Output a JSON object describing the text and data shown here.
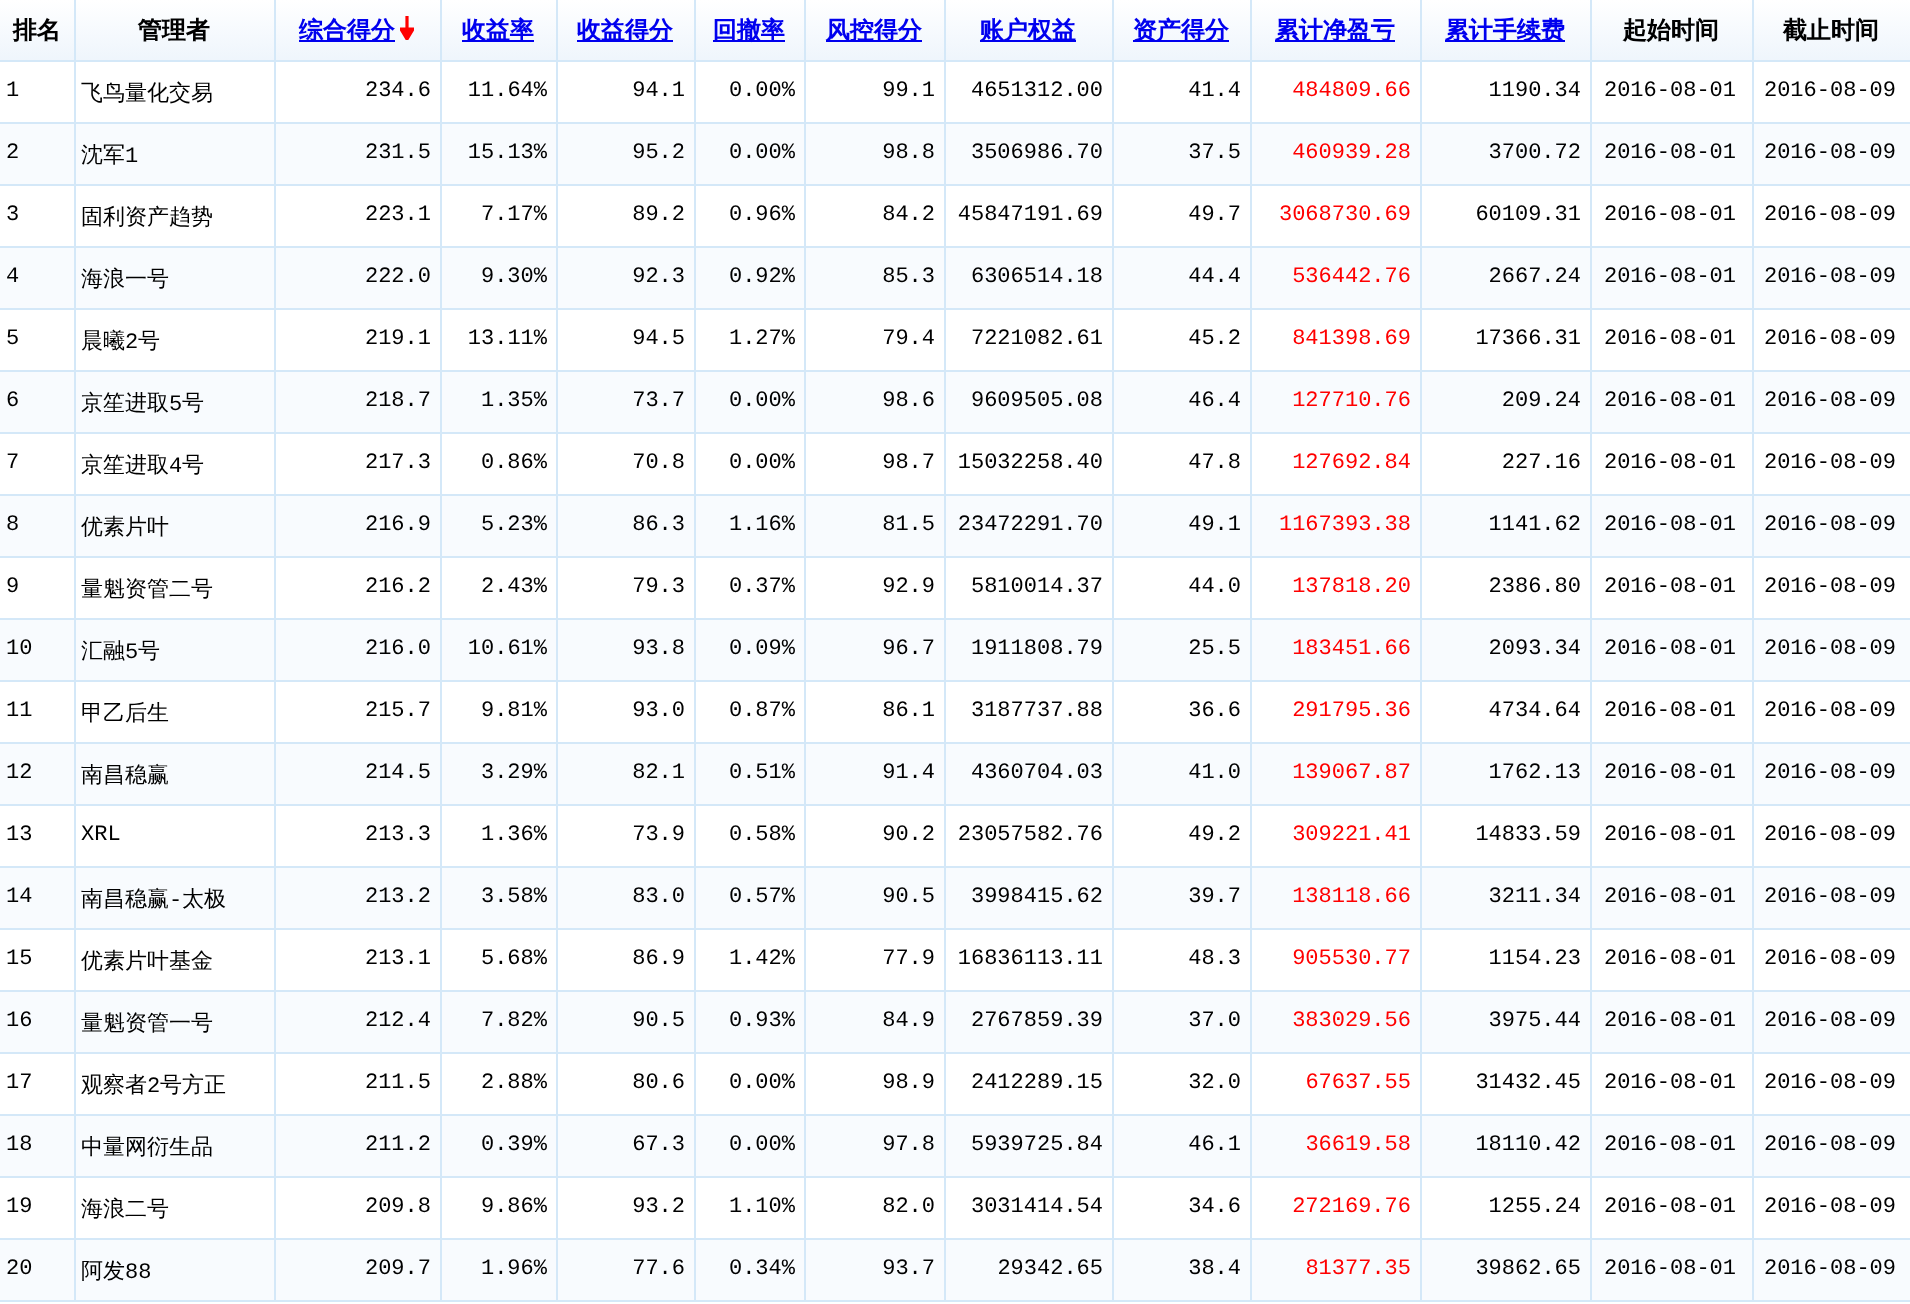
{
  "table": {
    "columns": [
      {
        "label": "排名",
        "kind": "plain"
      },
      {
        "label": "管理者",
        "kind": "plain"
      },
      {
        "label": "综合得分",
        "kind": "link",
        "sorted": true
      },
      {
        "label": "收益率",
        "kind": "link",
        "sorted": false
      },
      {
        "label": "收益得分",
        "kind": "link",
        "sorted": false
      },
      {
        "label": "回撤率",
        "kind": "link",
        "sorted": false
      },
      {
        "label": "风控得分",
        "kind": "link",
        "sorted": false
      },
      {
        "label": "账户权益",
        "kind": "link",
        "sorted": false
      },
      {
        "label": "资产得分",
        "kind": "link",
        "sorted": false
      },
      {
        "label": "累计净盈亏",
        "kind": "link",
        "sorted": false,
        "color": "#ff0000"
      },
      {
        "label": "累计手续费",
        "kind": "link",
        "sorted": false
      },
      {
        "label": "起始时间",
        "kind": "plain"
      },
      {
        "label": "截止时间",
        "kind": "plain"
      }
    ],
    "rows": [
      {
        "cells": [
          "1",
          "飞鸟量化交易",
          "234.6",
          "11.64%",
          "94.1",
          "0.00%",
          "99.1",
          "4651312.00",
          "41.4",
          "484809.66",
          "1190.34",
          "2016-08-01",
          "2016-08-09"
        ]
      },
      {
        "cells": [
          "2",
          "沈军1",
          "231.5",
          "15.13%",
          "95.2",
          "0.00%",
          "98.8",
          "3506986.70",
          "37.5",
          "460939.28",
          "3700.72",
          "2016-08-01",
          "2016-08-09"
        ]
      },
      {
        "cells": [
          "3",
          "固利资产趋势",
          "223.1",
          "7.17%",
          "89.2",
          "0.96%",
          "84.2",
          "45847191.69",
          "49.7",
          "3068730.69",
          "60109.31",
          "2016-08-01",
          "2016-08-09"
        ]
      },
      {
        "cells": [
          "4",
          "海浪一号",
          "222.0",
          "9.30%",
          "92.3",
          "0.92%",
          "85.3",
          "6306514.18",
          "44.4",
          "536442.76",
          "2667.24",
          "2016-08-01",
          "2016-08-09"
        ]
      },
      {
        "cells": [
          "5",
          "晨曦2号",
          "219.1",
          "13.11%",
          "94.5",
          "1.27%",
          "79.4",
          "7221082.61",
          "45.2",
          "841398.69",
          "17366.31",
          "2016-08-01",
          "2016-08-09"
        ]
      },
      {
        "cells": [
          "6",
          "京笙进取5号",
          "218.7",
          "1.35%",
          "73.7",
          "0.00%",
          "98.6",
          "9609505.08",
          "46.4",
          "127710.76",
          "209.24",
          "2016-08-01",
          "2016-08-09"
        ]
      },
      {
        "cells": [
          "7",
          "京笙进取4号",
          "217.3",
          "0.86%",
          "70.8",
          "0.00%",
          "98.7",
          "15032258.40",
          "47.8",
          "127692.84",
          "227.16",
          "2016-08-01",
          "2016-08-09"
        ]
      },
      {
        "cells": [
          "8",
          "优素片叶",
          "216.9",
          "5.23%",
          "86.3",
          "1.16%",
          "81.5",
          "23472291.70",
          "49.1",
          "1167393.38",
          "1141.62",
          "2016-08-01",
          "2016-08-09"
        ]
      },
      {
        "cells": [
          "9",
          "量魁资管二号",
          "216.2",
          "2.43%",
          "79.3",
          "0.37%",
          "92.9",
          "5810014.37",
          "44.0",
          "137818.20",
          "2386.80",
          "2016-08-01",
          "2016-08-09"
        ]
      },
      {
        "cells": [
          "10",
          "汇融5号",
          "216.0",
          "10.61%",
          "93.8",
          "0.09%",
          "96.7",
          "1911808.79",
          "25.5",
          "183451.66",
          "2093.34",
          "2016-08-01",
          "2016-08-09"
        ]
      },
      {
        "cells": [
          "11",
          "甲乙后生",
          "215.7",
          "9.81%",
          "93.0",
          "0.87%",
          "86.1",
          "3187737.88",
          "36.6",
          "291795.36",
          "4734.64",
          "2016-08-01",
          "2016-08-09"
        ]
      },
      {
        "cells": [
          "12",
          "南昌稳赢",
          "214.5",
          "3.29%",
          "82.1",
          "0.51%",
          "91.4",
          "4360704.03",
          "41.0",
          "139067.87",
          "1762.13",
          "2016-08-01",
          "2016-08-09"
        ]
      },
      {
        "cells": [
          "13",
          "XRL",
          "213.3",
          "1.36%",
          "73.9",
          "0.58%",
          "90.2",
          "23057582.76",
          "49.2",
          "309221.41",
          "14833.59",
          "2016-08-01",
          "2016-08-09"
        ]
      },
      {
        "cells": [
          "14",
          "南昌稳赢-太极",
          "213.2",
          "3.58%",
          "83.0",
          "0.57%",
          "90.5",
          "3998415.62",
          "39.7",
          "138118.66",
          "3211.34",
          "2016-08-01",
          "2016-08-09"
        ]
      },
      {
        "cells": [
          "15",
          "优素片叶基金",
          "213.1",
          "5.68%",
          "86.9",
          "1.42%",
          "77.9",
          "16836113.11",
          "48.3",
          "905530.77",
          "1154.23",
          "2016-08-01",
          "2016-08-09"
        ]
      },
      {
        "cells": [
          "16",
          "量魁资管一号",
          "212.4",
          "7.82%",
          "90.5",
          "0.93%",
          "84.9",
          "2767859.39",
          "37.0",
          "383029.56",
          "3975.44",
          "2016-08-01",
          "2016-08-09"
        ]
      },
      {
        "cells": [
          "17",
          "观察者2号方正",
          "211.5",
          "2.88%",
          "80.6",
          "0.00%",
          "98.9",
          "2412289.15",
          "32.0",
          "67637.55",
          "31432.45",
          "2016-08-01",
          "2016-08-09"
        ]
      },
      {
        "cells": [
          "18",
          "中量网衍生品",
          "211.2",
          "0.39%",
          "67.3",
          "0.00%",
          "97.8",
          "5939725.84",
          "46.1",
          "36619.58",
          "18110.42",
          "2016-08-01",
          "2016-08-09"
        ]
      },
      {
        "cells": [
          "19",
          "海浪二号",
          "209.8",
          "9.86%",
          "93.2",
          "1.10%",
          "82.0",
          "3031414.54",
          "34.6",
          "272169.76",
          "1255.24",
          "2016-08-01",
          "2016-08-09"
        ]
      },
      {
        "cells": [
          "20",
          "阿发88",
          "209.7",
          "1.96%",
          "77.6",
          "0.34%",
          "93.7",
          "29342.65",
          "38.4",
          "81377.35",
          "39862.65",
          "2016-08-01",
          "2016-08-09"
        ]
      }
    ]
  }
}
